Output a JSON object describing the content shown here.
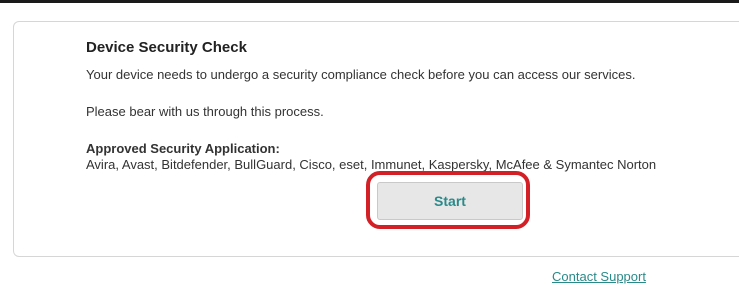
{
  "security_check": {
    "title": "Device Security Check",
    "description": "Your device needs to undergo a security compliance check before you can access our services.",
    "patience_note": "Please bear with us through this process.",
    "approved_label": "Approved Security Application:",
    "approved_list": "Avira, Avast, Bitdefender, BullGuard, Cisco, eset, Immunet, Kaspersky, McAfee & Symantec Norton",
    "start_label": "Start",
    "highlight_color": "#d32026"
  },
  "footer": {
    "support_link": "Contact Support"
  },
  "colors": {
    "link": "#2a8a8a",
    "button_bg": "#e7e7e7"
  }
}
